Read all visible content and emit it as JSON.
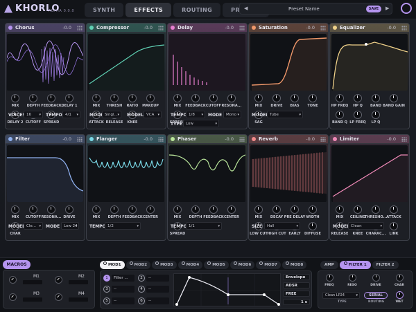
{
  "app": {
    "name": "KHORLO",
    "version": "ALPHA 0.0.0"
  },
  "tabs": [
    "SYNTH",
    "EFFECTS",
    "ROUTING",
    "PRESETS"
  ],
  "preset": {
    "name": "Preset Name",
    "save_label": "SAVE",
    "prev": "◀",
    "next": "▶"
  },
  "effects": [
    {
      "name": "Chorus",
      "value": "-0.0",
      "accent": "#b594ef",
      "knobs": [
        "MIX",
        "DEPTH",
        "FEEDBACK",
        "DELAY 1",
        "DELAY 2",
        "CUTOFF",
        "SPREAD"
      ],
      "rows": [
        {
          "labels": [
            "VOICES",
            "TEMPO"
          ],
          "values": [
            "16",
            "4/1"
          ]
        }
      ]
    },
    {
      "name": "Compressor",
      "value": "-0.0",
      "accent": "#5fd0b3",
      "knobs": [
        "MIX",
        "THRESH",
        "RATIO",
        "MAKEUP",
        "ATTACK",
        "RELEASE",
        "KNEE"
      ],
      "rows": [
        {
          "labels": [
            "MODE",
            "MODEL"
          ],
          "values": [
            "Singl...",
            "VCA"
          ]
        }
      ]
    },
    {
      "name": "Delay",
      "value": "-0.0",
      "accent": "#e67fcf",
      "knobs": [
        "MIX",
        "FEEDBACK",
        "CUTOFF",
        "RESONA...",
        "SPREAD"
      ],
      "rows": [
        {
          "labels": [
            "TEMPO",
            "MODE"
          ],
          "values": [
            "1/8",
            "Mono"
          ]
        },
        {
          "labels": [
            "TYPE"
          ],
          "values": [
            "Low"
          ]
        }
      ]
    },
    {
      "name": "Saturation",
      "value": "-0.0",
      "accent": "#f0986a",
      "knobs": [
        "MIX",
        "DRIVE",
        "BIAS",
        "TONE",
        "SAG"
      ],
      "rows": [
        {
          "labels": [
            "MODEL"
          ],
          "values": [
            "Tube"
          ]
        }
      ]
    },
    {
      "name": "Equalizer",
      "value": "-0.0",
      "accent": "#f0d28a",
      "knobs": [
        "HP FREQ",
        "HP Q",
        "BAND",
        "BAND GAIN",
        "BAND Q",
        "LP FREQ",
        "LP Q"
      ],
      "rows": []
    },
    {
      "name": "Filter",
      "value": "-0.0",
      "accent": "#8fb0ee",
      "knobs": [
        "MIX",
        "CUTOFF",
        "RESONA...",
        "DRIVE",
        "CHAR"
      ],
      "rows": [
        {
          "labels": [
            "MODEL",
            "MODE"
          ],
          "values": [
            "Cle...",
            "Low 24"
          ]
        }
      ]
    },
    {
      "name": "Flanger",
      "value": "-0.0",
      "accent": "#7ad8e6",
      "knobs": [
        "MIX",
        "DEPTH",
        "FEEDBACK",
        "CENTER"
      ],
      "rows": [
        {
          "labels": [
            "TEMPO"
          ],
          "values": [
            "1/2"
          ]
        }
      ]
    },
    {
      "name": "Phaser",
      "value": "-0.0",
      "accent": "#b8e49a",
      "knobs": [
        "MIX",
        "DEPTH",
        "FEEDBACK",
        "CENTER",
        "SPREAD"
      ],
      "rows": [
        {
          "labels": [
            "TEMPO"
          ],
          "values": [
            "1/1"
          ]
        }
      ]
    },
    {
      "name": "Reverb",
      "value": "-0.0",
      "accent": "#f08a8a",
      "knobs": [
        "MIX",
        "DECAY",
        "PRE DELAY",
        "WIDTH",
        "LOW CUT",
        "HIGH CUT",
        "EARLY",
        "DIFFUSE"
      ],
      "rows": [
        {
          "labels": [
            "SIZE"
          ],
          "values": [
            "Hall"
          ]
        }
      ]
    },
    {
      "name": "Limiter",
      "value": "-0.0",
      "accent": "#f08ab8",
      "knobs": [
        "MIX",
        "CEILING",
        "THRESHO...",
        "ATTACK",
        "RELEASE",
        "KNEE",
        "CHARAC...",
        "LINK"
      ],
      "rows": [
        {
          "labels": [
            "MODEL"
          ],
          "values": [
            "Clean"
          ]
        }
      ]
    }
  ],
  "macros": {
    "tab": "MACROS",
    "labels": [
      "M1",
      "M2",
      "M3",
      "M4"
    ]
  },
  "mod": {
    "tabs": [
      "MOD1",
      "MOD2",
      "MOD3",
      "MOD4",
      "MOD5",
      "MOD6",
      "MOD7",
      "MOD8"
    ],
    "slots": [
      {
        "num": "1",
        "text": "Filter ..."
      },
      {
        "num": "2",
        "text": "--"
      },
      {
        "num": "3",
        "text": "--"
      },
      {
        "num": "4",
        "text": "--"
      },
      {
        "num": "5",
        "text": "--"
      },
      {
        "num": "6",
        "text": "--"
      }
    ],
    "options": [
      "Envelope",
      "ADSR",
      "FREE",
      "1 s"
    ]
  },
  "filter": {
    "tabs": [
      "AMP",
      "FILTER 1",
      "FILTER 2"
    ],
    "knobs": [
      "FREQ",
      "RESO",
      "DRIVE",
      "CHAR"
    ],
    "model": "Clean LP24",
    "routing": "SERIAL",
    "type_label": "TYPE",
    "routing_label": "ROUTING",
    "wet_label": "WET"
  }
}
